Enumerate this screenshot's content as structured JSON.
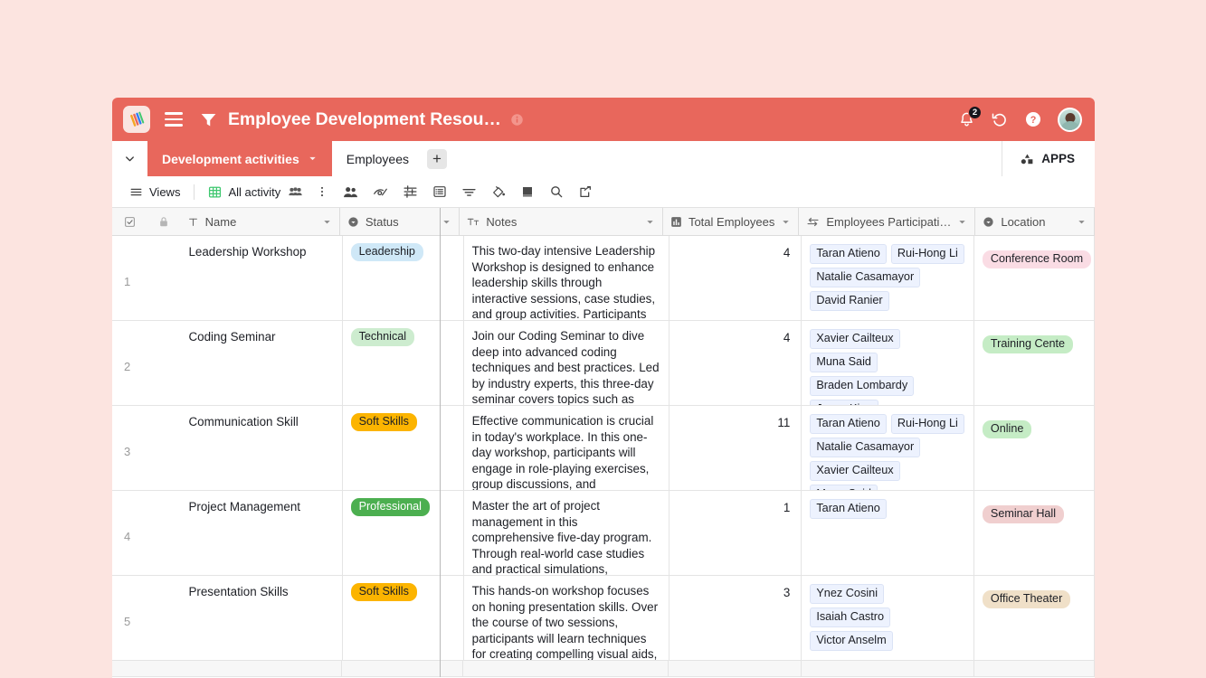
{
  "topbar": {
    "logo_icon": "airtable-logo-icon",
    "menu_icon": "hamburger-menu-icon",
    "filter_icon": "filter-funnel-icon",
    "title": "Employee Development Resou…",
    "info_icon": "info-circle-icon",
    "notification_icon": "bell-icon",
    "notification_count": "2",
    "history_icon": "history-undo-icon",
    "help_icon": "help-question-icon",
    "avatar_icon": "user-avatar"
  },
  "tabstrip": {
    "collapse_icon": "chevron-down-icon",
    "tabs": [
      {
        "label": "Development activities",
        "active": true,
        "caret_icon": "chevron-down-icon"
      },
      {
        "label": "Employees",
        "active": false
      }
    ],
    "add_tab_label": "+",
    "apps_label": "APPS",
    "apps_icon": "apps-grid-icon"
  },
  "toolbar": {
    "views_label": "Views",
    "views_icon": "hamburger-list-icon",
    "view_name": "All activity",
    "view_icon": "grid-green-icon",
    "collaborators_icon": "people-small-icon",
    "more_icon": "kebab-more-icon",
    "items": [
      {
        "icon": "group-people-icon"
      },
      {
        "icon": "hide-fields-eye-icon"
      },
      {
        "icon": "filter-sliders-icon"
      },
      {
        "icon": "group-rows-icon"
      },
      {
        "icon": "sort-icon"
      },
      {
        "icon": "color-fill-icon"
      },
      {
        "icon": "row-height-icon"
      },
      {
        "icon": "search-icon"
      },
      {
        "icon": "share-export-icon"
      }
    ]
  },
  "grid": {
    "select_all_icon": "checkbox-icon",
    "lock_icon": "lock-icon",
    "columns": [
      {
        "key": "name",
        "label": "Name",
        "type_icon": "text-T-icon",
        "caret": true
      },
      {
        "key": "status",
        "label": "Status",
        "type_icon": "single-select-icon",
        "caret": true
      },
      {
        "key": "notes",
        "label": "Notes",
        "type_icon": "long-text-icon",
        "caret": true
      },
      {
        "key": "total",
        "label": "Total Employees",
        "type_icon": "count-bar-icon",
        "caret": true
      },
      {
        "key": "part",
        "label": "Employees Participati…",
        "type_icon": "link-record-icon",
        "caret": true
      },
      {
        "key": "location",
        "label": "Location",
        "type_icon": "single-select-icon",
        "caret": true
      }
    ],
    "rows": [
      {
        "num": "1",
        "name": "Leadership Workshop",
        "status": {
          "label": "Leadership",
          "bg": "#cfe8f7",
          "fg": "#1d1f25"
        },
        "notes": "This two-day intensive Leadership Workshop is designed to enhance leadership skills through interactive sessions, case studies, and group activities. Participants will learn about",
        "total": "4",
        "participants": [
          "Taran Atieno",
          "Rui-Hong Li",
          "Natalie Casamayor",
          "David Ranier"
        ],
        "location": {
          "label": "Conference Room",
          "bg": "#fadce4",
          "fg": "#1d1f25"
        }
      },
      {
        "num": "2",
        "name": "Coding Seminar",
        "status": {
          "label": "Technical",
          "bg": "#cdeccf",
          "fg": "#1d1f25"
        },
        "notes": "Join our Coding Seminar to dive deep into advanced coding techniques and best practices. Led by industry experts, this three-day seminar covers topics such as algorithms,",
        "total": "4",
        "participants": [
          "Xavier Cailteux",
          "Muna Said",
          "Braden Lombardy",
          "Jesse King"
        ],
        "location": {
          "label": "Training Cente",
          "bg": "#c5ecc5",
          "fg": "#1d1f25"
        }
      },
      {
        "num": "3",
        "name": "Communication Skill",
        "status": {
          "label": "Soft Skills",
          "bg": "#fcb400",
          "fg": "#1d1f25"
        },
        "notes": "Effective communication is crucial in today's workplace. In this one-day workshop, participants will engage in role-playing exercises, group discussions, and presentations to",
        "total": "11",
        "participants": [
          "Taran Atieno",
          "Rui-Hong Li",
          "Natalie Casamayor",
          "Xavier Cailteux",
          "Muna Said"
        ],
        "location": {
          "label": "Online",
          "bg": "#c5ecc5",
          "fg": "#1d1f25"
        }
      },
      {
        "num": "4",
        "name": "Project Management",
        "status": {
          "label": "Professional",
          "bg": "#4caf50",
          "fg": "#ffffff"
        },
        "notes": "Master the art of project management in this comprehensive five-day program. Through real-world case studies and practical simulations, participants will develop",
        "total": "1",
        "participants": [
          "Taran Atieno"
        ],
        "location": {
          "label": "Seminar Hall",
          "bg": "#f0cfcf",
          "fg": "#1d1f25"
        }
      },
      {
        "num": "5",
        "name": "Presentation Skills",
        "status": {
          "label": "Soft Skills",
          "bg": "#fcb400",
          "fg": "#1d1f25"
        },
        "notes": "This hands-on workshop focuses on honing presentation skills. Over the course of two sessions, participants will learn techniques for creating compelling visual aids, delivering",
        "total": "3",
        "participants": [
          "Ynez Cosini",
          "Isaiah Castro",
          "Victor Anselm"
        ],
        "location": {
          "label": "Office Theater",
          "bg": "#f0e0c8",
          "fg": "#1d1f25"
        }
      }
    ]
  },
  "theme": {
    "accent": "#e8675c",
    "page_bg": "#fce4e0",
    "header_bg": "#f7f7f7"
  }
}
